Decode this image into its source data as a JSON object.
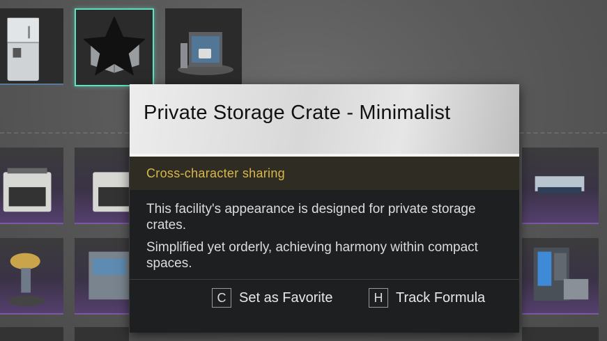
{
  "tooltip": {
    "title": "Private Storage Crate - Minimalist",
    "tag": "Cross-character sharing",
    "description": [
      "This facility's appearance is designed for private storage crates.",
      "Simplified yet orderly, achieving harmony within compact spaces."
    ],
    "actions": [
      {
        "key": "C",
        "label": "Set as Favorite"
      },
      {
        "key": "H",
        "label": "Track Formula"
      }
    ]
  },
  "grid": {
    "selected_item": "private-storage-crate",
    "favorite_icon": "star-icon",
    "colors": {
      "selection": "#5fe0c0",
      "rarity_epic": "#7a5aa0",
      "tag_text": "#d9b84a"
    }
  }
}
